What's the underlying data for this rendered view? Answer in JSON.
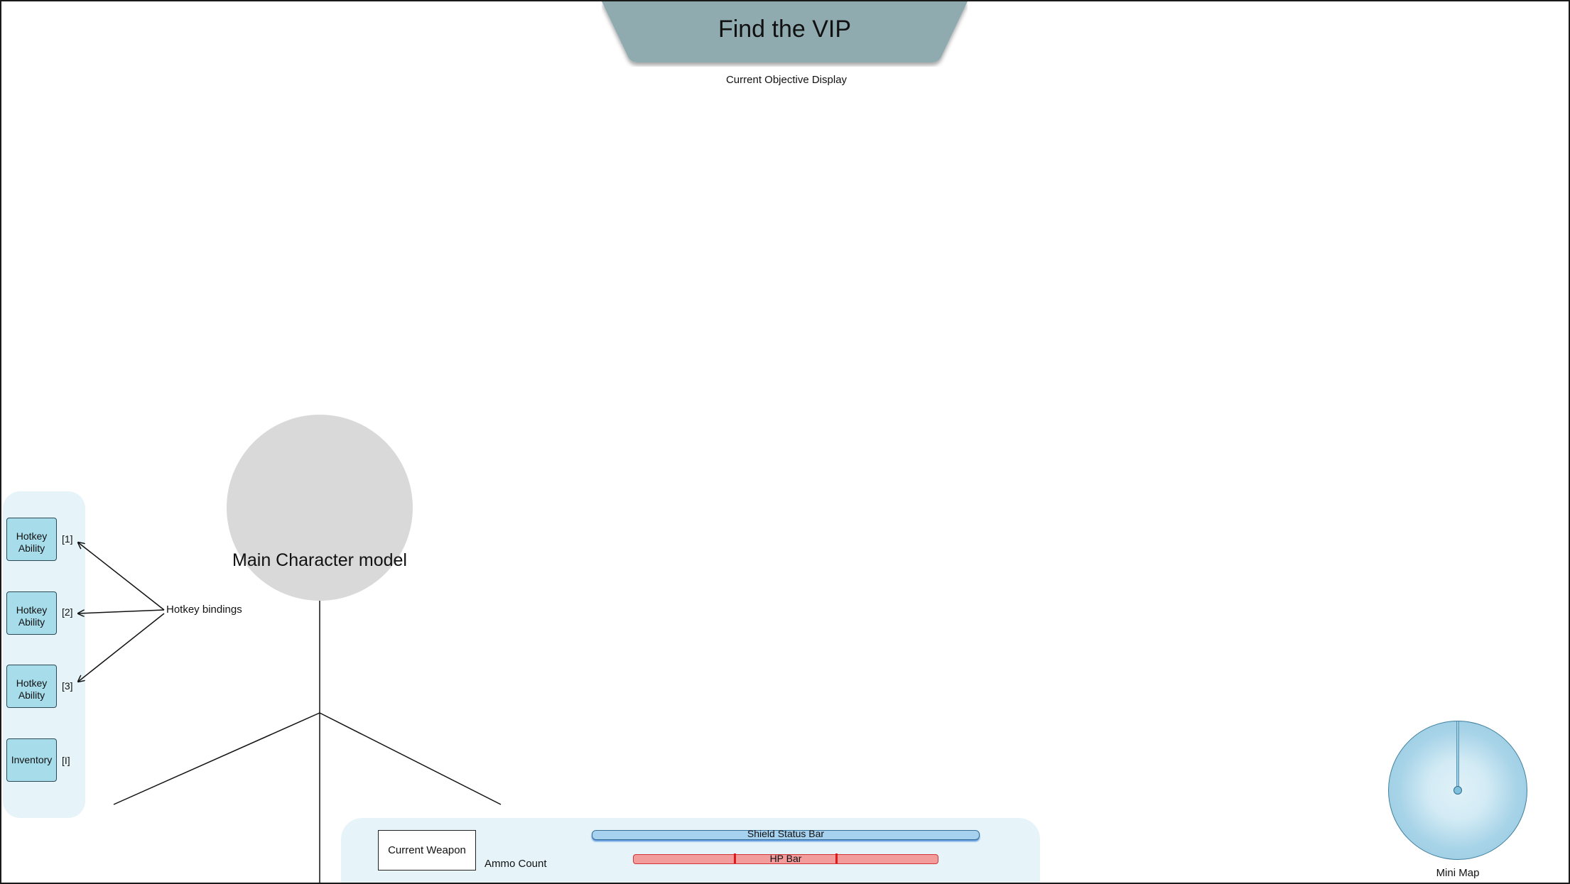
{
  "objective": {
    "title": "Find the VIP",
    "caption": "Current Objective Display"
  },
  "hotkeys": {
    "items": [
      {
        "label": "Hotkey Ability",
        "key": "[1]"
      },
      {
        "label": "Hotkey Ability",
        "key": "[2]"
      },
      {
        "label": "Hotkey Ability",
        "key": "[3]"
      },
      {
        "label": "Inventory",
        "key": "[I]"
      }
    ],
    "annotation": "Hotkey bindings"
  },
  "character": {
    "label": "Main Character model"
  },
  "bottom_bar": {
    "weapon_label": "Current Weapon",
    "ammo_label": "Ammo Count",
    "shield_label": "Shield Status Bar",
    "hp_label": "HP Bar"
  },
  "minimap": {
    "label": "Mini Map"
  },
  "colors": {
    "banner": "#90abb0",
    "hotkey_fill": "#a7dceb",
    "panel_bg": "#e6f4f9",
    "shield": "#a6d1ef",
    "hp": "#f29c9c",
    "character": "#d9d9d9"
  }
}
